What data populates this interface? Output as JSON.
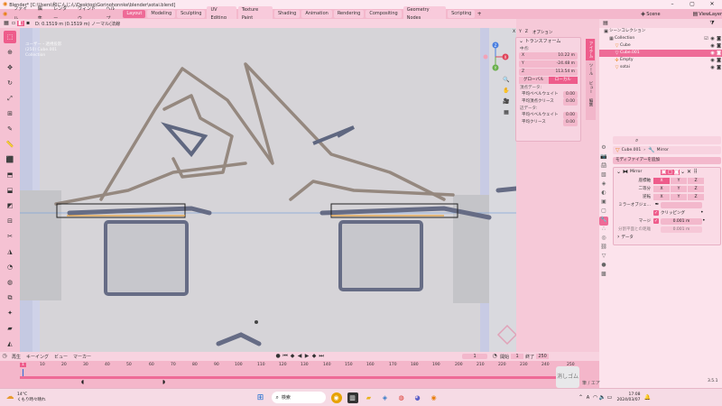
{
  "title_bar": {
    "title": "Blender* [C:\\Users\\和にんじん\\Desktop\\Gorinohonnke\\blender\\sotai.blend]"
  },
  "menu": {
    "items": [
      "ファイル",
      "編集",
      "レンダー",
      "ウィンドウ",
      "ヘルプ"
    ],
    "workspaces": [
      "Layout",
      "Modeling",
      "Sculpting",
      "UV Editing",
      "Texture Paint",
      "Shading",
      "Animation",
      "Rendering",
      "Compositing",
      "Geometry Nodes",
      "Scripting"
    ],
    "active_workspace": "Layout",
    "scene_label": "Scene",
    "viewlayer_label": "ViewLayer"
  },
  "viewport_header": {
    "status": "D: 0.1519 m (0.1519 m) ノーマル(法線"
  },
  "viewport_info": {
    "lines": [
      "ユーザー・透視投影",
      "(250) Cube.001",
      "Collection"
    ]
  },
  "gizmo": {
    "z": "Z",
    "x": "X",
    "y": "Y"
  },
  "transform_panel": {
    "header": "トランスフォーム",
    "options_label": "オプション",
    "xyz_header": [
      "X",
      "Y",
      "Z"
    ],
    "median_label": "中点:",
    "x_label": "X",
    "x_value": "10.22 m",
    "y_label": "Y",
    "y_value": "-24.48 m",
    "z_label": "Z",
    "z_value": "113.54 m",
    "global_label": "グローバル",
    "local_label": "ローカル",
    "vertex_data_label": "頂点データ:",
    "bevel_weight_label": "平均ベベルウェイト",
    "bevel_weight_value": "0.00",
    "vertex_crease_label": "平均頂点クリース",
    "vertex_crease_value": "0.00",
    "edge_data_label": "辺データ:",
    "edge_bevel_label": "平均ベベルウェイト",
    "edge_bevel_value": "0.00",
    "edge_crease_label": "平均クリース",
    "edge_crease_value": "0.00"
  },
  "vertical_tabs": [
    "アイテム",
    "ツール",
    "ビュー",
    "編集"
  ],
  "outliner": {
    "title": "シーンコレクション",
    "items": [
      {
        "name": "Collection",
        "indent": 1,
        "selected": false
      },
      {
        "name": "Cube",
        "indent": 2,
        "selected": false
      },
      {
        "name": "Cube.001",
        "indent": 2,
        "selected": true
      },
      {
        "name": "Empty",
        "indent": 2,
        "selected": false
      },
      {
        "name": "sotai",
        "indent": 2,
        "selected": false
      }
    ]
  },
  "properties": {
    "object_name": "Cube.001",
    "modifier_type": "Mirror",
    "add_modifier_label": "モディファイアーを追加",
    "modifier_name": "Mirror",
    "axis_label": "座標軸",
    "bisect_label": "二等分",
    "flip_label": "逆転",
    "axis_buttons": [
      "X",
      "Y",
      "Z"
    ],
    "mirror_object_label": "ミラーオブジェ...",
    "clipping_label": "クリッピング",
    "merge_label": "マージ",
    "merge_value": "0.001 m",
    "bisect_distance_label": "分割平面との距離",
    "bisect_distance_value": "0.001 m",
    "data_label": "データ"
  },
  "timeline": {
    "playback_label": "再生",
    "keying_label": "キーイング",
    "view_label": "ビュー",
    "marker_label": "マーカー",
    "current_frame": "1",
    "start_label": "開始",
    "start_value": "1",
    "end_label": "終了",
    "end_value": "250",
    "ticks": [
      "1",
      "10",
      "20",
      "30",
      "40",
      "50",
      "60",
      "70",
      "80",
      "90",
      "100",
      "110",
      "120",
      "130",
      "140",
      "150",
      "160",
      "170",
      "180",
      "190",
      "200",
      "210",
      "220",
      "230",
      "240",
      "250"
    ],
    "frame_indicator": "1"
  },
  "version": "3.5.1",
  "taskbar": {
    "weather_temp": "14°C",
    "weather_desc": "くもり時々晴れ",
    "search_label": "検索",
    "time": "17:08",
    "date": "2024/03/07",
    "ime_label": "A"
  },
  "watermark": {
    "label": "消しゴム",
    "corner_label": "筆 / エア"
  },
  "colors": {
    "accent": "#ee5c8b",
    "panel": "#fce3ec",
    "viewport": "#d6d4d8"
  }
}
